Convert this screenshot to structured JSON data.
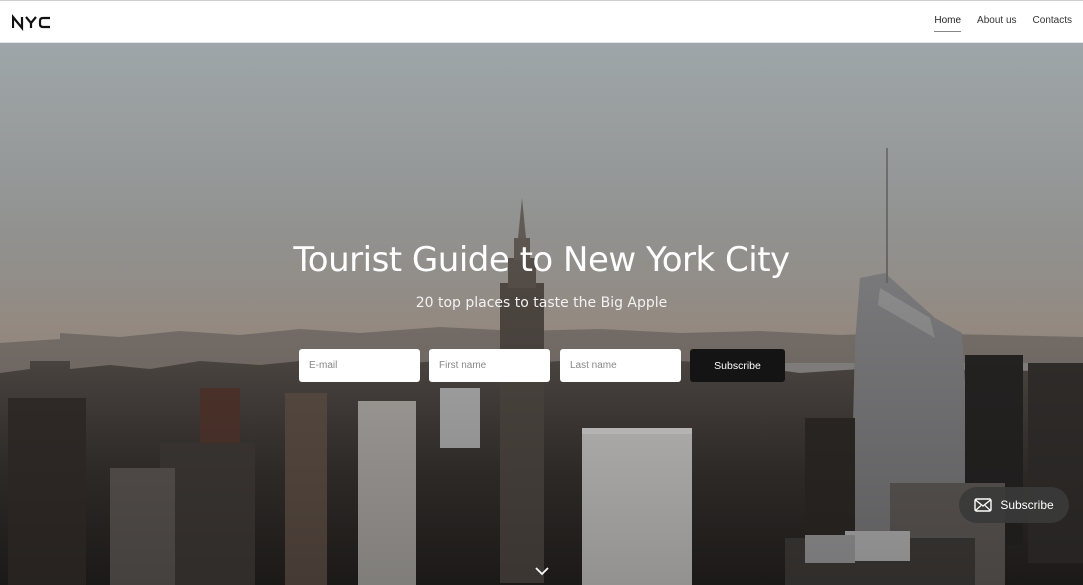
{
  "navbar": {
    "logo_text": "NYC",
    "links": [
      {
        "label": "Home",
        "active": true
      },
      {
        "label": "About us",
        "active": false
      },
      {
        "label": "Contacts",
        "active": false
      }
    ]
  },
  "hero": {
    "title": "Tourist Guide to New York City",
    "subtitle": "20 top places to taste the Big Apple",
    "form": {
      "email_placeholder": "E-mail",
      "first_name_placeholder": "First name",
      "last_name_placeholder": "Last name",
      "submit_label": "Subscribe"
    },
    "scroll_icon": "chevron-down-icon"
  },
  "floating_button": {
    "label": "Subscribe",
    "icon": "envelope-icon"
  },
  "colors": {
    "navbar_bg": "#ffffff",
    "submit_bg": "#141414",
    "fab_bg": "#3a3a3a",
    "text_on_hero": "#ffffff"
  }
}
